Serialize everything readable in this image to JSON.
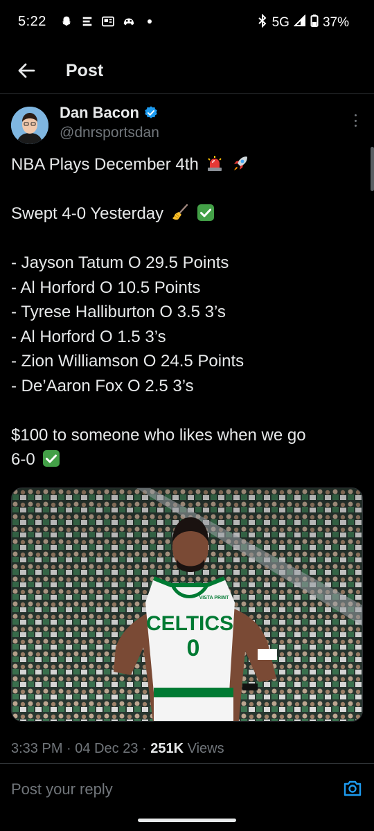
{
  "status_bar": {
    "time": "5:22",
    "network": "5G",
    "battery": "37%",
    "icons_left": [
      "snapchat-icon",
      "app-e-icon",
      "news-icon",
      "game-icon",
      "dot-icon"
    ],
    "icons_right": [
      "bluetooth-icon",
      "signal-icon",
      "battery-icon"
    ]
  },
  "header": {
    "title": "Post"
  },
  "post": {
    "author_name": "Dan Bacon",
    "author_handle": "@dnrsportsdan",
    "verified": true,
    "line_title": "NBA Plays December 4th",
    "line_swept": "Swept 4-0 Yesterday",
    "picks": [
      "- Jayson Tatum O 29.5 Points",
      "- Al Horford O 10.5 Points",
      "- Tyrese Halliburton O 3.5 3’s",
      "- Al Horford O 1.5 3’s",
      "- Zion Williamson O 24.5 Points",
      "- De’Aaron Fox O 2.5 3’s"
    ],
    "promo_line1": "$100 to someone who likes when we go",
    "promo_line2": "6-0",
    "jersey_text": "CELTICS",
    "jersey_number": "0",
    "jersey_sponsor": "VISTA PRINT"
  },
  "meta": {
    "time": "3:33 PM",
    "date": "04 Dec 23",
    "views_count": "251K",
    "views_label": "Views"
  },
  "reply": {
    "placeholder": "Post your reply"
  },
  "colors": {
    "background": "#000000",
    "text": "#e7e9ea",
    "muted": "#71767b",
    "accent": "#1d9bf0",
    "divider": "#2f3336",
    "celtics_green": "#007a33"
  }
}
